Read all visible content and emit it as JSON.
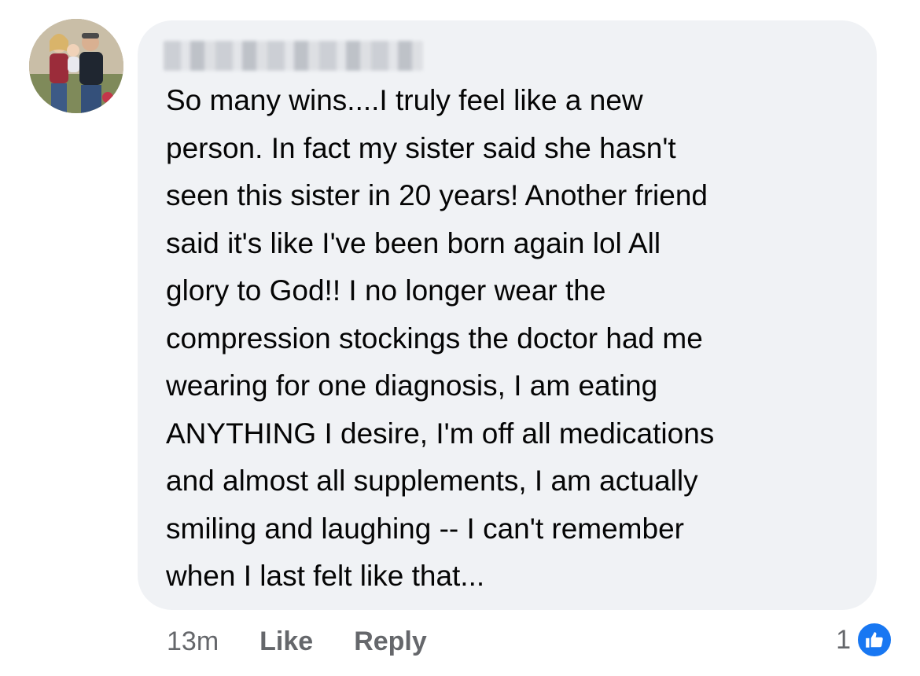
{
  "comment": {
    "text_lines": [
      "So many wins....I truly feel like a new",
      "person. In fact my sister said she hasn't",
      "seen this sister in 20 years! Another friend",
      "said it's like I've been born again lol All",
      "glory to God!! I no longer wear the",
      "compression stockings the doctor had me",
      "wearing for one diagnosis, I am eating",
      "ANYTHING I desire, I'm off all medications",
      "and almost all supplements, I am actually",
      "smiling and laughing -- I can't remember",
      "when I last felt like that..."
    ]
  },
  "actions": {
    "time": "13m",
    "like_label": "Like",
    "reply_label": "Reply"
  },
  "reactions": {
    "count": "1",
    "icon": "thumbs-up-icon",
    "badge_color": "#1877f2"
  },
  "colors": {
    "bubble": "#f0f2f5",
    "text": "#050505",
    "meta": "#65676b"
  }
}
